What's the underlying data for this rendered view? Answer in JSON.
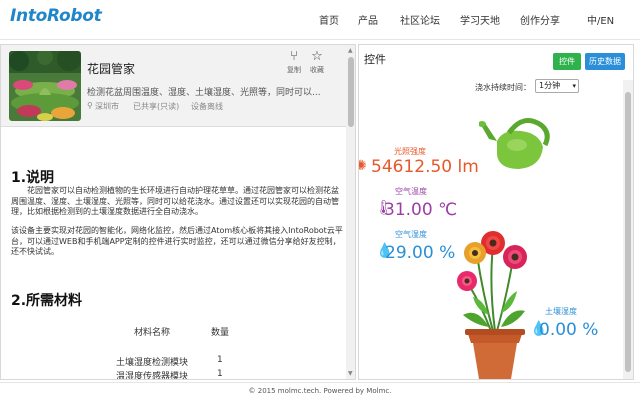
{
  "header": {
    "logo": "IntoRobot",
    "nav": [
      "首页",
      "产品",
      "社区论坛",
      "学习天地",
      "创作分享"
    ],
    "lang": "中/EN"
  },
  "device": {
    "title": "花园管家",
    "description": "检测花盆周围温度、湿度、土壤湿度、光照等，同时可以...",
    "location": "深圳市",
    "share": "已共享(只读)",
    "status": "设备离线",
    "actions": {
      "copy": "复制",
      "favorite": "收藏"
    }
  },
  "article": {
    "section1_title": "1.说明",
    "section1_text": "花园管家可以自动检测植物的生长环境进行自动护理花草草。通过花园管家可以检测花盆周围温度、湿度、土壤湿度、光照等，同时可以给花浇水。通过设置还可以实现花园的自动管理，比如根据检测到的土壤湿度数据进行全自动浇水。",
    "section1_text2": "该设备主要实现对花园的智能化，网络化监控，然后通过Atom核心板将其接入IntoRobot云平台，可以通过WEB和手机端APP定制的控件进行实时监控，还可以通过微信分享给好友控制，还不快试试。",
    "section2_title": "2.所需材料",
    "table": {
      "headers": [
        "材料名称",
        "数量"
      ],
      "rows": [
        [
          "土壤湿度检测模块",
          "1"
        ],
        [
          "温湿度传感器模块",
          "1"
        ]
      ]
    }
  },
  "controls": {
    "title": "控件",
    "control_button": "控件",
    "history_button": "历史数据",
    "duration_label": "浇水持续时间：",
    "duration_value": "1分钟",
    "sensors": {
      "light": {
        "label": "光照强度",
        "value": "54612.50 lm"
      },
      "temperature": {
        "label": "空气温度",
        "value": "31.00 ℃"
      },
      "humidity": {
        "label": "空气湿度",
        "value": "29.00 %"
      },
      "soil": {
        "label": "土壤湿度",
        "value": "0.00 %"
      }
    }
  },
  "colors": {
    "brand": "#1f86c9",
    "green_button": "#2fb24c",
    "blue_button": "#2a8fd8",
    "light": "#e8572a",
    "temp": "#9b3fa5",
    "humidity": "#2a8fd8"
  },
  "footer": "© 2015 molmc.tech. Powered by Molmc."
}
